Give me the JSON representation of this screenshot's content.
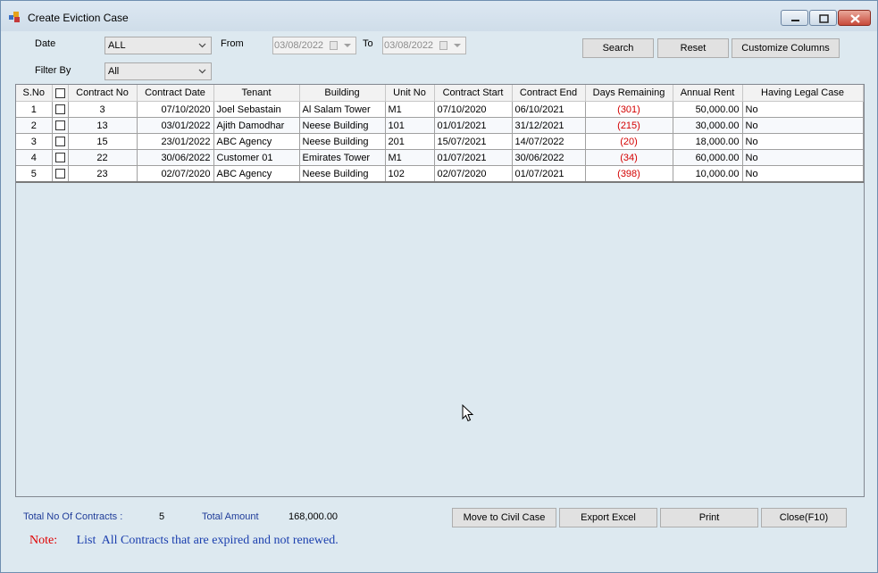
{
  "window": {
    "title": "Create Eviction Case"
  },
  "filters": {
    "date_label": "Date",
    "date_value": "ALL",
    "from_label": "From",
    "from_value": "03/08/2022",
    "to_label": "To",
    "to_value": "03/08/2022",
    "filter_by_label": "Filter By",
    "filter_by_value": "All"
  },
  "toolbar": {
    "search_label": "Search",
    "reset_label": "Reset",
    "customize_label": "Customize Columns"
  },
  "table": {
    "columns": [
      "S.No",
      "",
      "Contract No",
      "Contract Date",
      "Tenant",
      "Building",
      "Unit No",
      "Contract Start",
      "Contract End",
      "Days Remaining",
      "Annual Rent",
      "Having Legal Case"
    ],
    "rows": [
      {
        "sno": "1",
        "contract_no": "3",
        "contract_date": "07/10/2020",
        "tenant": "Joel Sebastain",
        "building": "Al Salam Tower",
        "unit": "M1",
        "start": "07/10/2020",
        "end": "06/10/2021",
        "days": "(301)",
        "rent": "50,000.00",
        "legal": "No"
      },
      {
        "sno": "2",
        "contract_no": "13",
        "contract_date": "03/01/2022",
        "tenant": "Ajith Damodhar",
        "building": "Neese Building",
        "unit": "101",
        "start": "01/01/2021",
        "end": "31/12/2021",
        "days": "(215)",
        "rent": "30,000.00",
        "legal": "No"
      },
      {
        "sno": "3",
        "contract_no": "15",
        "contract_date": "23/01/2022",
        "tenant": "ABC Agency",
        "building": "Neese Building",
        "unit": "201",
        "start": "15/07/2021",
        "end": "14/07/2022",
        "days": "(20)",
        "rent": "18,000.00",
        "legal": "No"
      },
      {
        "sno": "4",
        "contract_no": "22",
        "contract_date": "30/06/2022",
        "tenant": "Customer 01",
        "building": "Emirates Tower",
        "unit": "M1",
        "start": "01/07/2021",
        "end": "30/06/2022",
        "days": "(34)",
        "rent": "60,000.00",
        "legal": "No"
      },
      {
        "sno": "5",
        "contract_no": "23",
        "contract_date": "02/07/2020",
        "tenant": "ABC Agency",
        "building": "Neese Building",
        "unit": "102",
        "start": "02/07/2020",
        "end": "01/07/2021",
        "days": "(398)",
        "rent": "10,000.00",
        "legal": "No"
      }
    ]
  },
  "footer": {
    "total_contracts_label": "Total No Of Contracts :",
    "total_contracts_value": "5",
    "total_amount_label": "Total Amount",
    "total_amount_value": "168,000.00",
    "move_label": "Move to Civil Case",
    "export_label": "Export Excel",
    "print_label": "Print",
    "close_label": "Close(F10)",
    "note_label": "Note:",
    "note_text": "List  All Contracts that are expired and not renewed."
  },
  "colors": {
    "accent_red": "#d40000",
    "label_blue": "#1f3c99"
  }
}
